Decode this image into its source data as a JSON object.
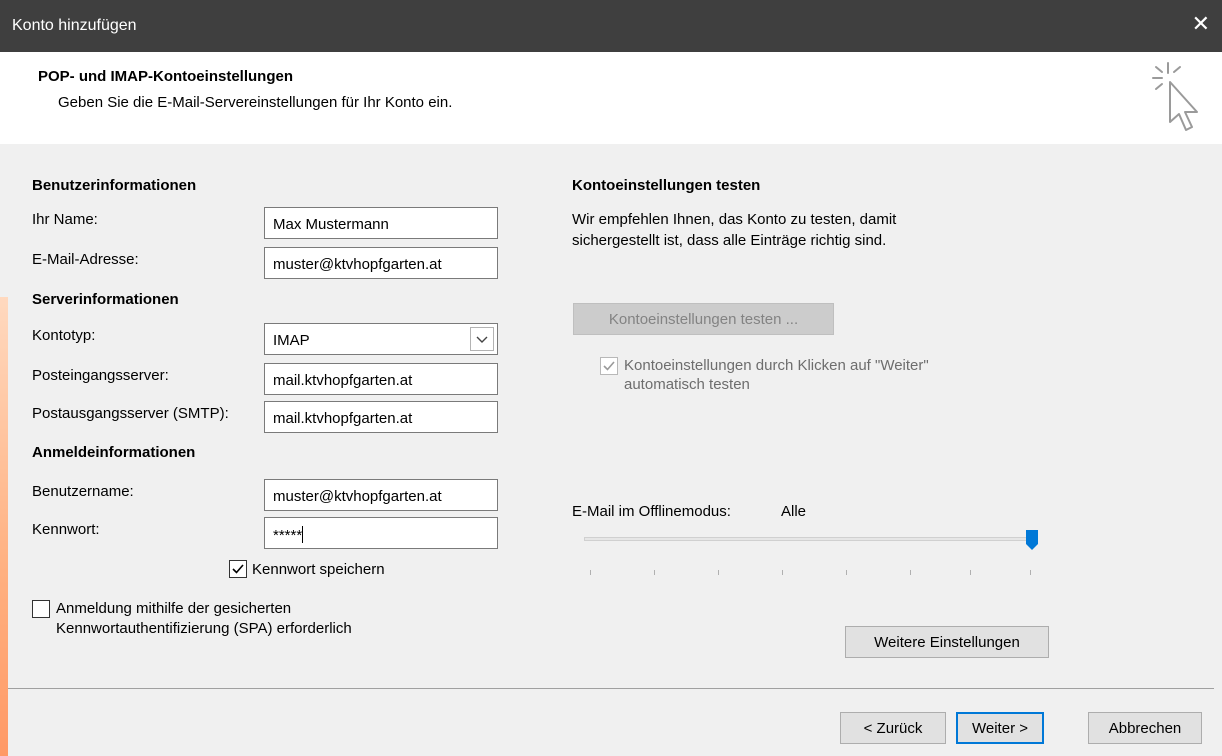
{
  "window": {
    "title": "Konto hinzufügen",
    "close_glyph": "✕"
  },
  "header": {
    "title": "POP- und IMAP-Kontoeinstellungen",
    "subtitle": "Geben Sie die E-Mail-Servereinstellungen für Ihr Konto ein.",
    "icon": "click-cursor-icon"
  },
  "user_info": {
    "heading": "Benutzerinformationen",
    "name_label": "Ihr Name:",
    "name_value": "Max Mustermann",
    "email_label": "E-Mail-Adresse:",
    "email_value": "muster@ktvhopfgarten.at"
  },
  "server_info": {
    "heading": "Serverinformationen",
    "account_type_label": "Kontotyp:",
    "account_type_value": "IMAP",
    "incoming_label": "Posteingangsserver:",
    "incoming_value": "mail.ktvhopfgarten.at",
    "outgoing_label": "Postausgangsserver (SMTP):",
    "outgoing_value": "mail.ktvhopfgarten.at"
  },
  "login_info": {
    "heading": "Anmeldeinformationen",
    "username_label": "Benutzername:",
    "username_value": "muster@ktvhopfgarten.at",
    "password_label": "Kennwort:",
    "password_value": "*****",
    "remember_label": "Kennwort speichern",
    "remember_checked": true,
    "spa_label_line1": "Anmeldung mithilfe der gesicherten",
    "spa_label_line2": "Kennwortauthentifizierung (SPA) erforderlich",
    "spa_checked": false
  },
  "test_settings": {
    "heading": "Kontoeinstellungen testen",
    "description_line1": "Wir empfehlen Ihnen, das Konto zu testen, damit",
    "description_line2": "sichergestellt ist, dass alle Einträge richtig sind.",
    "test_button": "Kontoeinstellungen testen ...",
    "auto_test_line1": "Kontoeinstellungen durch Klicken auf \"Weiter\"",
    "auto_test_line2": "automatisch testen",
    "auto_test_checked": true
  },
  "offline": {
    "label": "E-Mail im Offlinemodus:",
    "value": "Alle",
    "slider_level": 1.0
  },
  "more_settings_button": "Weitere Einstellungen",
  "footer": {
    "back": "< Zurück",
    "next": "Weiter >",
    "cancel": "Abbrechen"
  },
  "colors": {
    "titlebar": "#3f3f3f",
    "content_bg": "#f0f0f0",
    "accent_blue": "#0078d7",
    "slider_thumb": "#0078d7"
  }
}
